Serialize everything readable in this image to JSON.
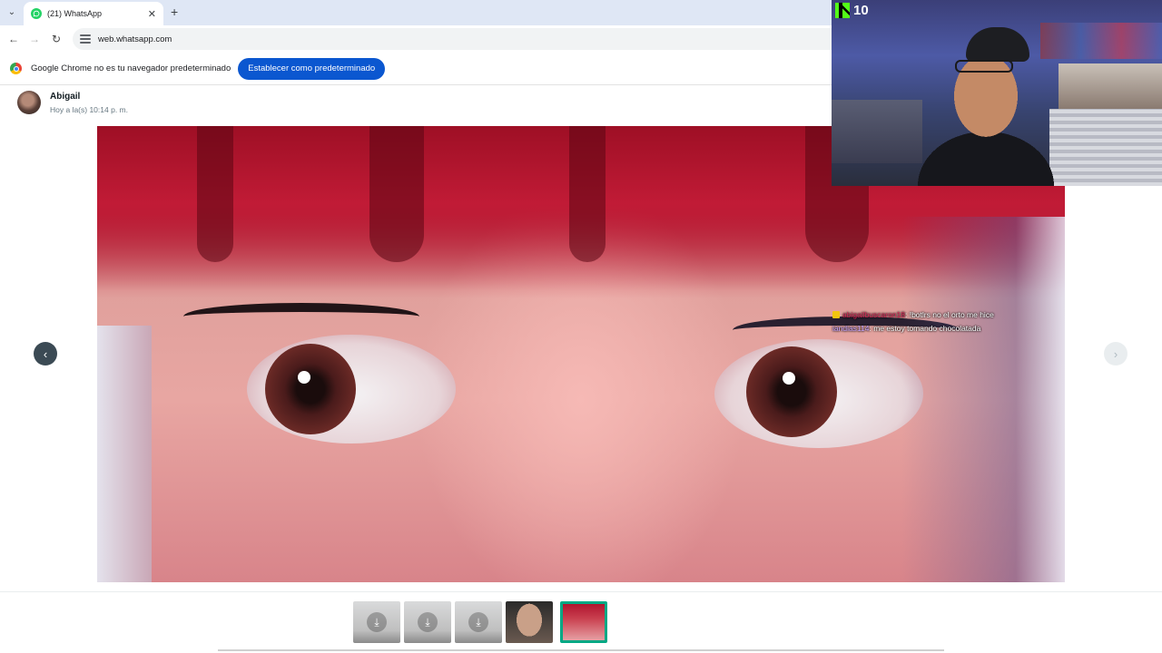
{
  "browser": {
    "tab_title": "(21) WhatsApp",
    "tab_close": "✕",
    "new_tab": "+",
    "url": "web.whatsapp.com"
  },
  "infobar": {
    "message": "Google Chrome no es tu navegador predeterminado",
    "button_label": "Establecer como predeterminado"
  },
  "viewer": {
    "sender_name": "Abigail",
    "sent_time": "Hoy a la(s) 10:14 p. m."
  },
  "chat_overlay": {
    "messages": [
      {
        "user": "abigailbuscaron18",
        "text": ": !botlrs no el orto me hice"
      },
      {
        "user": "iandias114",
        "text": ": me estoy tomando chocolatada"
      }
    ]
  },
  "stream": {
    "viewer_count": "10"
  },
  "thumbnails": [
    {
      "kind": "download"
    },
    {
      "kind": "download"
    },
    {
      "kind": "download"
    },
    {
      "kind": "image"
    },
    {
      "kind": "image",
      "active": true
    }
  ],
  "colors": {
    "accent_blue": "#0b57d0",
    "whatsapp_green": "#00a884",
    "kick_green": "#53fc18"
  }
}
